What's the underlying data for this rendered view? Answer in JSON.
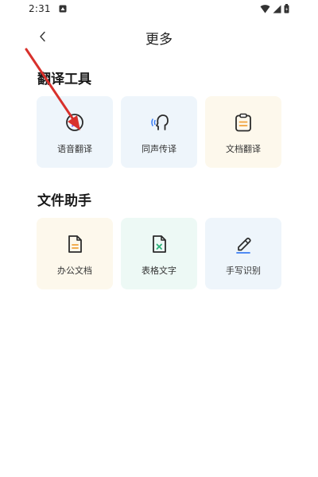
{
  "status_bar": {
    "time": "2:31"
  },
  "header": {
    "title": "更多"
  },
  "sections": [
    {
      "title": "翻译工具",
      "cards": [
        {
          "label": "语音翻译",
          "icon": "voice-translate-icon",
          "bg": "#eef5fb",
          "accent": "#2b2b2b",
          "dot": "#7b5cf0"
        },
        {
          "label": "同声传译",
          "icon": "simultaneous-interpretation-icon",
          "bg": "#eef5fb",
          "accent": "#2b2b2b",
          "dot": "#3a7cf3"
        },
        {
          "label": "文档翻译",
          "icon": "document-translate-icon",
          "bg": "#fdf8ec",
          "accent": "#2b2b2b",
          "dot": "#f0a23a"
        }
      ]
    },
    {
      "title": "文件助手",
      "cards": [
        {
          "label": "办公文档",
          "icon": "office-document-icon",
          "bg": "#fdf8ec",
          "accent": "#2b2b2b",
          "dot": "#f0a23a"
        },
        {
          "label": "表格文字",
          "icon": "table-text-icon",
          "bg": "#edf9f5",
          "accent": "#2b2b2b",
          "dot": "#2bb37a"
        },
        {
          "label": "手写识别",
          "icon": "handwriting-recognition-icon",
          "bg": "#eef5fb",
          "accent": "#2b2b2b",
          "dot": "#3a7cf3"
        }
      ]
    }
  ],
  "annotation": {
    "color": "#d8312c"
  }
}
